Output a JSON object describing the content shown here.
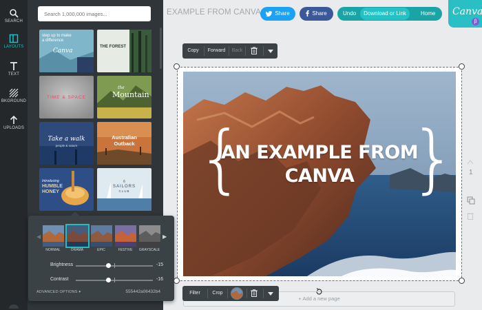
{
  "rail": {
    "items": [
      {
        "label": "SEARCH",
        "icon": "search-icon"
      },
      {
        "label": "LAYOUTS",
        "icon": "layouts-icon"
      },
      {
        "label": "TEXT",
        "icon": "text-icon"
      },
      {
        "label": "BKGROUND",
        "icon": "background-icon"
      },
      {
        "label": "UPLOADS",
        "icon": "upload-icon"
      }
    ],
    "active": "LAYOUTS"
  },
  "panel": {
    "search_placeholder": "Search 1,000,000 images...",
    "layouts": [
      {
        "line1": "step up to make",
        "line2": "a difference",
        "brand": "Canva"
      },
      {
        "line1": "THE FOREST"
      },
      {
        "line1": "TIME & SPACE"
      },
      {
        "line1": "the",
        "line2": "Mountain"
      },
      {
        "line1": "Take a walk",
        "line2": "people & nature"
      },
      {
        "line1": "Australian",
        "line2": "Outback"
      },
      {
        "line1": "Introducing",
        "line2": "HUMBLE",
        "line3": "HONEY"
      },
      {
        "line1": "6",
        "line2": "SAILORS",
        "line3": "CLUB"
      }
    ]
  },
  "filters": {
    "items": [
      "NORMAL",
      "DRAMA",
      "EPIC",
      "FESTIVE",
      "GRAYSCALE"
    ],
    "selected": "DRAMA",
    "brightness_label": "Brightness",
    "brightness_value": "-15",
    "contrast_label": "Contrast",
    "contrast_value": "-16",
    "advanced_label": "ADVANCED OPTIONS",
    "code": "555442a06432b4"
  },
  "header": {
    "title": "EXAMPLE FROM CANVA",
    "twitter_label": "Share",
    "facebook_label": "Share",
    "undo_label": "Undo",
    "download_label": "Download or Link",
    "home_label": "Home",
    "logo_text": "Canva",
    "beta": "β"
  },
  "top_toolbar": {
    "copy": "Copy",
    "forward": "Forward",
    "back": "Back"
  },
  "bottom_toolbar": {
    "filter": "Filter",
    "crop": "Crop"
  },
  "canvas": {
    "headline_line1": "AN EXAMPLE FROM",
    "headline_line2": "CANVA",
    "add_page": "+ Add a new page",
    "page_number": "1"
  },
  "colors": {
    "accent": "#1ec0c8",
    "twitter": "#1da1f2",
    "facebook": "#3b5998",
    "dark": "#2f3538"
  }
}
